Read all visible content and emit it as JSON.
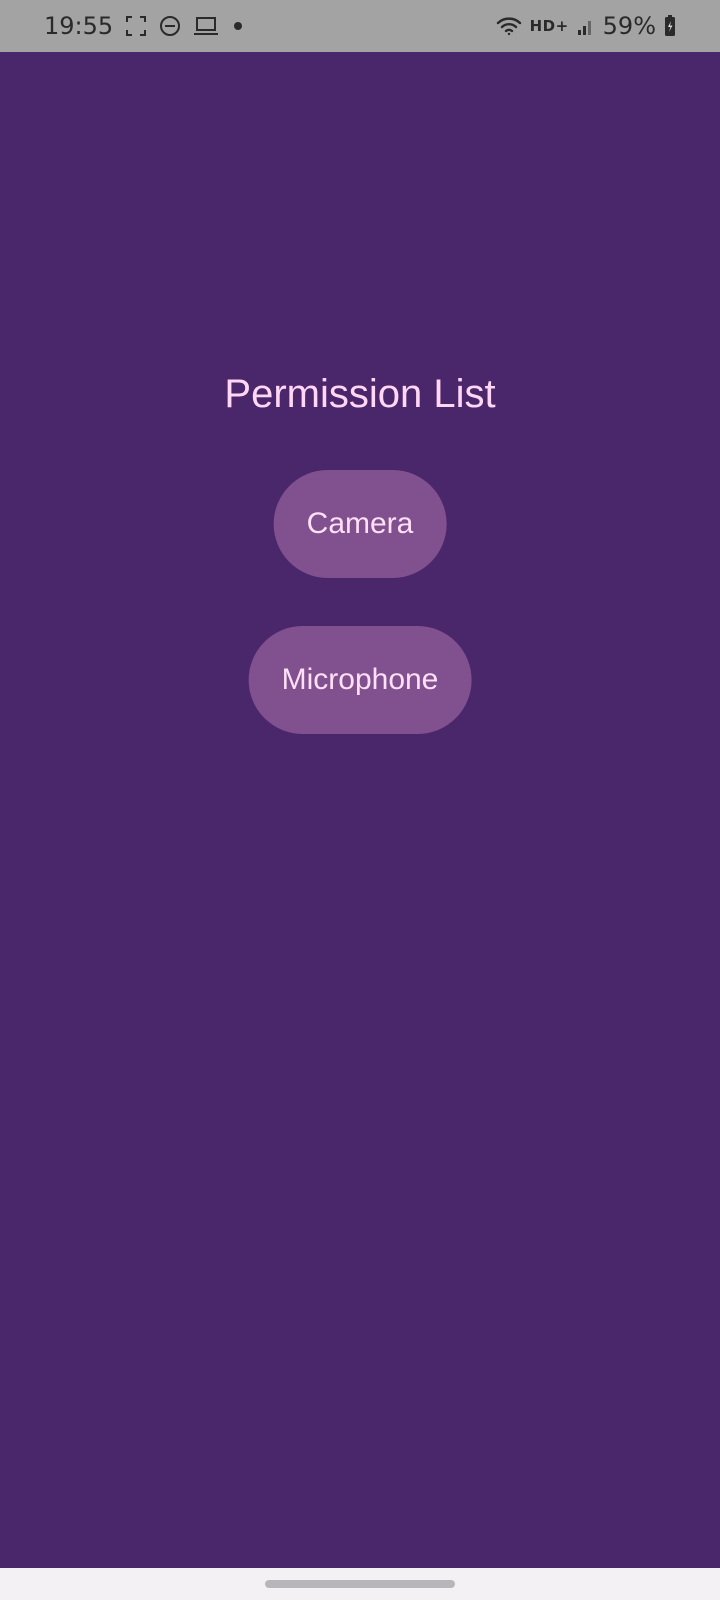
{
  "status_bar": {
    "time": "19:55",
    "network_label": "HD+",
    "battery": "59%",
    "icons": [
      "screenshot-icon",
      "do-not-disturb-icon",
      "laptop-icon",
      "notification-dot-icon",
      "wifi-icon",
      "signal-icon",
      "battery-icon"
    ]
  },
  "screen": {
    "title": "Permission List",
    "buttons": [
      {
        "label": "Camera"
      },
      {
        "label": "Microphone"
      }
    ]
  },
  "colors": {
    "background": "#4a266b",
    "button": "#80508f",
    "text": "#ffd7f5",
    "status_bar": "#a3a3a3",
    "nav_bar": "#f3f1f4"
  }
}
